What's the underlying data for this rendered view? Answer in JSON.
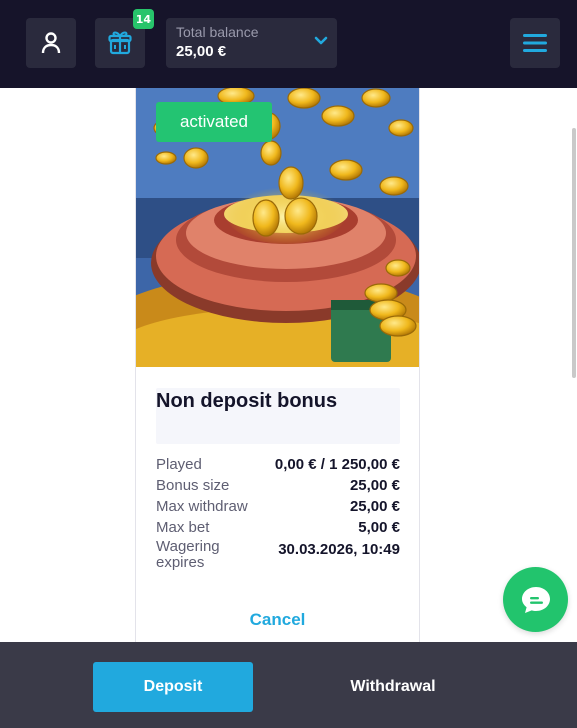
{
  "header": {
    "profile_icon": "user-icon",
    "gift_icon": "gift-icon",
    "gift_badge": "14",
    "balance_label": "Total balance",
    "balance_value": "25,00 €",
    "menu_icon": "hamburger-menu-icon"
  },
  "bonus": {
    "status": "activated",
    "title": "Non deposit bonus",
    "details": [
      {
        "label": "Played",
        "value": "0,00 € / 1 250,00 €"
      },
      {
        "label": "Bonus size",
        "value": "25,00 €"
      },
      {
        "label": "Max withdraw",
        "value": "25,00 €"
      },
      {
        "label": "Max bet",
        "value": "5,00 €"
      },
      {
        "label": "Wagering expires",
        "value": "30.03.2026, 10:49"
      }
    ],
    "cancel_label": "Cancel"
  },
  "footer": {
    "deposit_label": "Deposit",
    "withdrawal_label": "Withdrawal"
  },
  "chat_icon": "chat-bubble-icon",
  "colors": {
    "header_bg": "#16142a",
    "accent_blue": "#21a9de",
    "accent_green": "#23c472",
    "footer_bg": "#3a3a48"
  }
}
